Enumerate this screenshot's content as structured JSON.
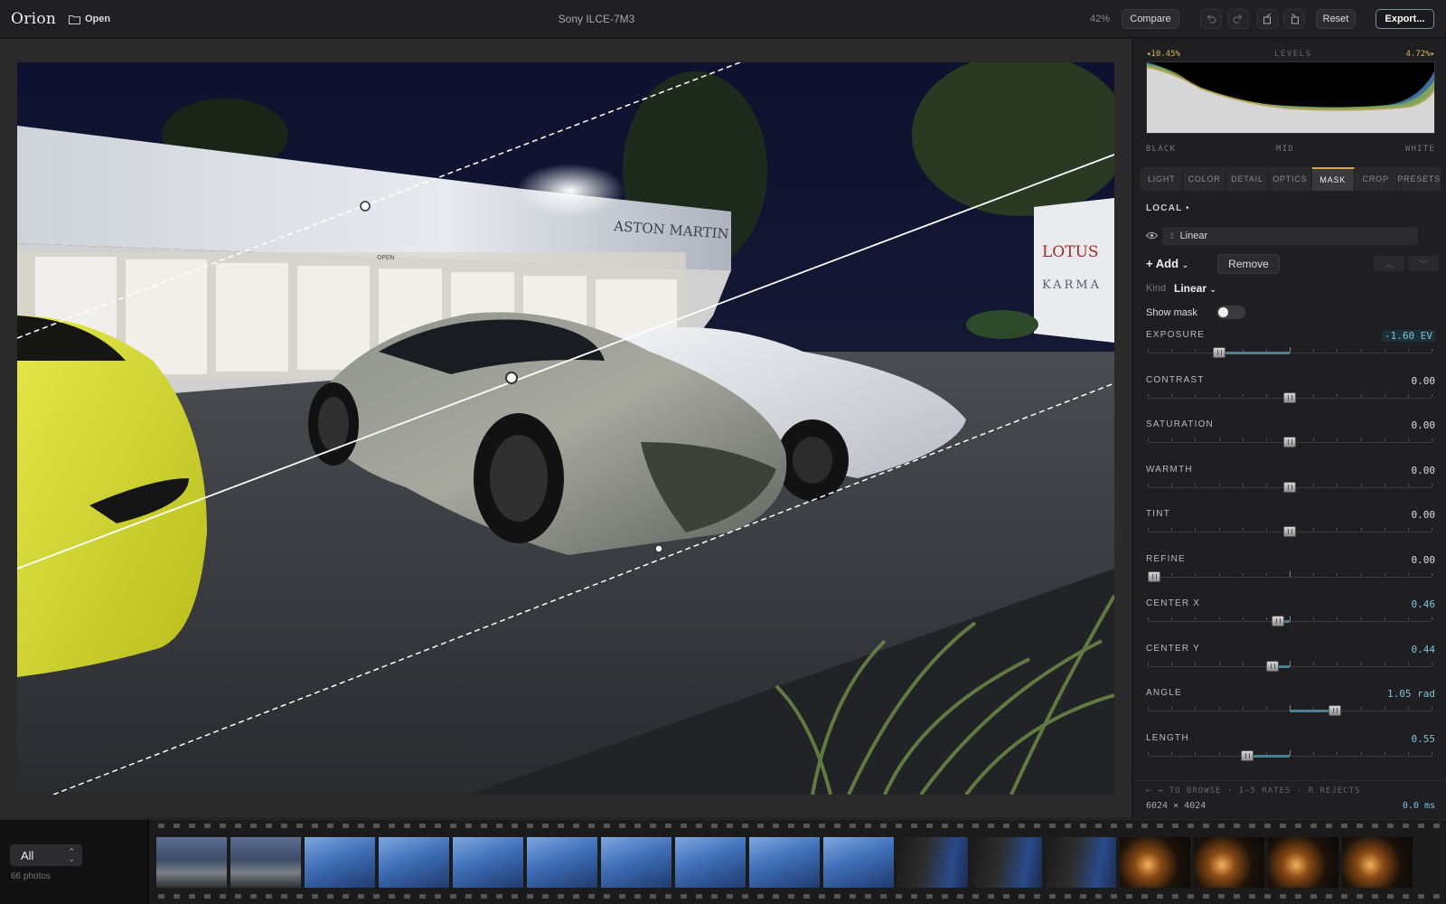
{
  "app": {
    "name": "Orion",
    "open_label": "Open"
  },
  "header": {
    "camera": "Sony ILCE-7M3",
    "zoom": "42%",
    "compare_label": "Compare",
    "reset_label": "Reset",
    "export_label": "Export..."
  },
  "photo": {
    "sign_brand": "ASTON MARTIN",
    "sign_open": "OPEN",
    "sign_side_1": "LOTUS",
    "sign_side_2": "KARMA"
  },
  "histogram": {
    "left_value": "10.45%",
    "title": "LEVELS",
    "right_value": "4.72%",
    "label_black": "BLACK",
    "label_mid": "MID",
    "label_white": "WHITE"
  },
  "tabs": [
    {
      "label": "LIGHT"
    },
    {
      "label": "COLOR"
    },
    {
      "label": "DETAIL"
    },
    {
      "label": "OPTICS"
    },
    {
      "label": "MASK",
      "active": true
    },
    {
      "label": "CROP"
    },
    {
      "label": "PRESETS"
    }
  ],
  "mask": {
    "section_label": "LOCAL",
    "dot": "•",
    "item_number": "1",
    "item_name": "Linear",
    "add_label": "Add",
    "remove_label": "Remove",
    "kind_label": "Kind",
    "kind_value": "Linear",
    "show_mask_label": "Show mask",
    "show_mask_on": false
  },
  "sliders": [
    {
      "name": "EXPOSURE",
      "value": "-1.60 EV",
      "pos": 0.25,
      "style": "ev"
    },
    {
      "name": "CONTRAST",
      "value": "0.00",
      "pos": 0.5,
      "style": ""
    },
    {
      "name": "SATURATION",
      "value": "0.00",
      "pos": 0.5,
      "style": ""
    },
    {
      "name": "WARMTH",
      "value": "0.00",
      "pos": 0.5,
      "style": ""
    },
    {
      "name": "TINT",
      "value": "0.00",
      "pos": 0.5,
      "style": ""
    },
    {
      "name": "REFINE",
      "value": "0.00",
      "pos": 0.0,
      "style": ""
    },
    {
      "name": "CENTER X",
      "value": "0.46",
      "pos": 0.46,
      "style": "changed"
    },
    {
      "name": "CENTER Y",
      "value": "0.44",
      "pos": 0.44,
      "style": "changed"
    },
    {
      "name": "ANGLE",
      "value": "1.05 rad",
      "pos": 0.66,
      "style": "changed"
    },
    {
      "name": "LENGTH",
      "value": "0.55",
      "pos": 0.35,
      "style": "changed"
    }
  ],
  "footer": {
    "hint": "← → TO BROWSE · 1–5 RATES · R REJECTS",
    "dimensions": "6024 × 4024",
    "render_time": "0.0 ms"
  },
  "filmstrip": {
    "filter_value": "All",
    "count_label": "66 photos",
    "thumbs": [
      "street",
      "street",
      "blue",
      "blue",
      "blue",
      "blue",
      "blue",
      "blue",
      "blue",
      "blue",
      "dusk",
      "dusk",
      "dusk",
      "night",
      "night",
      "night",
      "night"
    ]
  },
  "colors": {
    "accent": "#7cc3d9",
    "tab_active": "#d6a24a",
    "highlight": "#d6b661"
  }
}
